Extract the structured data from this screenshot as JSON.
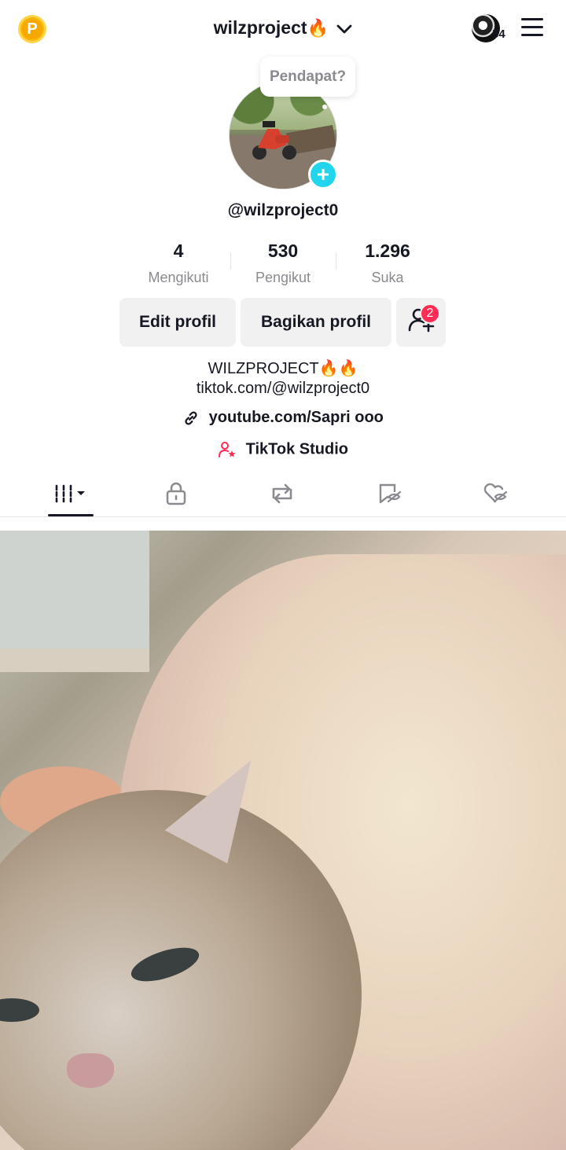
{
  "header": {
    "username": "wilzproject",
    "username_emoji": "🔥",
    "story_count": "54"
  },
  "profile": {
    "tooltip": "Pendapat?",
    "handle": "@wilzproject0",
    "stats": [
      {
        "value": "4",
        "label": "Mengikuti"
      },
      {
        "value": "530",
        "label": "Pengikut"
      },
      {
        "value": "1.296",
        "label": "Suka"
      }
    ],
    "buttons": {
      "edit": "Edit profil",
      "share": "Bagikan profil",
      "add_friend_badge": "2"
    },
    "bio_line1": "WILZPROJECT🔥🔥",
    "bio_line2": "tiktok.com/@wilzproject0",
    "link": "youtube.com/Sapri ooo",
    "studio": "TikTok Studio"
  },
  "tabs": [
    "videos-tab",
    "private-tab",
    "reposts-tab",
    "favorites-tab",
    "liked-tab"
  ],
  "colors": {
    "accent": "#fe2c55",
    "cyan": "#20d5ec",
    "coin": "#f9b800",
    "muted_text": "#8a8b91"
  }
}
